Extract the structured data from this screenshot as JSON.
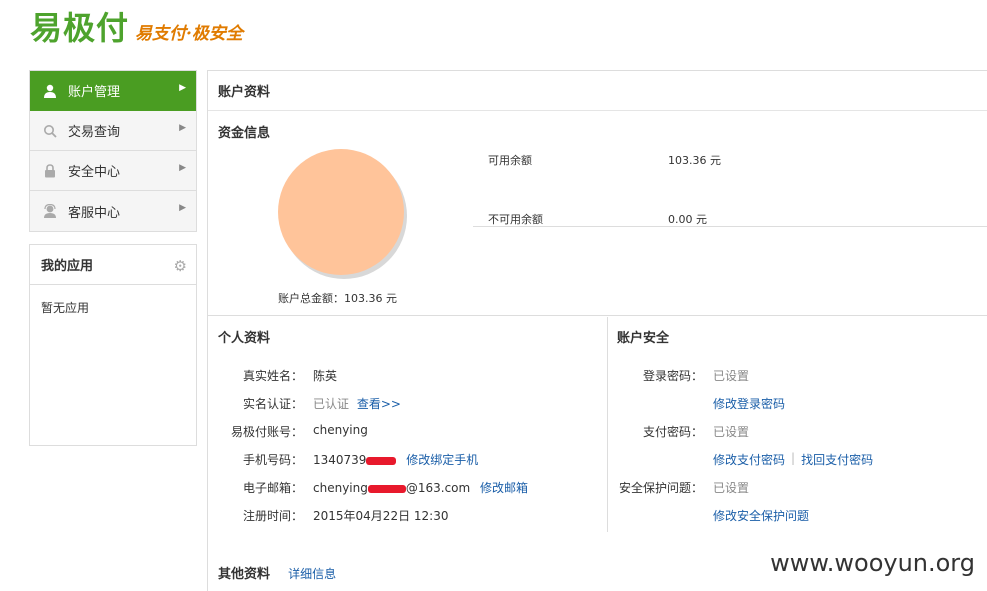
{
  "brand": {
    "name": "易极付",
    "slogan": "易支付·极安全"
  },
  "sidebar": {
    "items": [
      {
        "label": "账户管理",
        "icon": "user-icon",
        "active": true
      },
      {
        "label": "交易查询",
        "icon": "search-icon",
        "active": false
      },
      {
        "label": "安全中心",
        "icon": "lock-icon",
        "active": false
      },
      {
        "label": "客服中心",
        "icon": "support-icon",
        "active": false
      }
    ],
    "apps": {
      "title": "我的应用",
      "empty": "暂无应用"
    }
  },
  "main": {
    "title": "账户资料",
    "funds": {
      "title": "资金信息",
      "total_label": "账户总金额：103.36 元",
      "available_label": "可用余额",
      "available_value": "103.36 元",
      "unavailable_label": "不可用余额",
      "unavailable_value": "0.00 元"
    },
    "personal": {
      "title": "个人资料",
      "name_label": "真实姓名：",
      "name_value": "陈英",
      "verify_label": "实名认证：",
      "verify_value": "已认证",
      "verify_link": "查看>>",
      "account_label": "易极付账号：",
      "account_value": "chenying",
      "phone_label": "手机号码：",
      "phone_value": "1340739",
      "phone_link": "修改绑定手机",
      "email_label": "电子邮箱：",
      "email_prefix": "chenying",
      "email_suffix": "@163.com",
      "email_link": "修改邮箱",
      "reg_label": "注册时间：",
      "reg_value": "2015年04月22日 12:30"
    },
    "security": {
      "title": "账户安全",
      "login_label": "登录密码：",
      "login_value": "已设置",
      "login_link": "修改登录密码",
      "pay_label": "支付密码：",
      "pay_value": "已设置",
      "pay_link": "修改支付密码",
      "pay_sep": "|",
      "pay_recover_link": "找回支付密码",
      "question_label": "安全保护问题：",
      "question_value": "已设置",
      "question_link": "修改安全保护问题"
    },
    "other": {
      "title": "其他资料",
      "link": "详细信息"
    }
  },
  "colors": {
    "brand_green": "#4ea32d",
    "slogan_orange": "#e07b00",
    "pie_fill": "#ffc49a",
    "link_blue": "#1a5ea8"
  },
  "watermark": "www.wooyun.org"
}
